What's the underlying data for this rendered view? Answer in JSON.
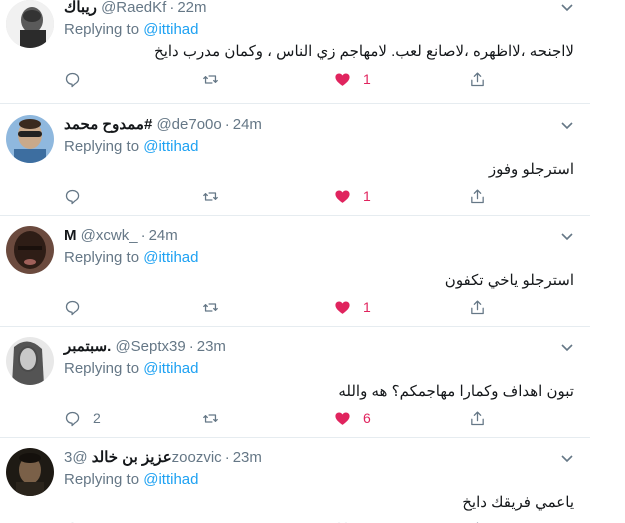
{
  "replying_label": "Replying to",
  "tweets": [
    {
      "name": "ريباك",
      "handle": "@RaedKf",
      "time": "22m",
      "reply_to": "@ittihad",
      "text": "لااجنحه ،لااظهره ،لاصانع لعب. لامهاجم زي الناس ، وكمان مدرب دايخ",
      "replies": "",
      "likes": "1",
      "avatar_bg": "#2b2b2b"
    },
    {
      "name": "ممدوح محمد#",
      "handle": "@de7o0o",
      "time": "24m",
      "reply_to": "@ittihad",
      "text": "استرجلو وفوز",
      "replies": "",
      "likes": "1",
      "avatar_bg": "#4a7fb0"
    },
    {
      "name": "M",
      "handle": "@xcwk_",
      "time": "24m",
      "reply_to": "@ittihad",
      "text": "استرجلو ياخي تكفون",
      "replies": "",
      "likes": "1",
      "avatar_bg": "#3a2a24"
    },
    {
      "name": "سبتمبر.",
      "handle": "@Septx39",
      "time": "23m",
      "reply_to": "@ittihad",
      "text": "تبون اهداف وكمارا مهاجمكم؟ هه والله",
      "replies": "2",
      "likes": "6",
      "avatar_bg": "#bfbfbf"
    },
    {
      "name": "عزيز بن خالد",
      "handle": "@3zoozvic",
      "time": "23m",
      "reply_to": "@ittihad",
      "text": "ياعمي فريقك دايخ",
      "replies": "",
      "likes": "",
      "avatar_bg": "#3c3020"
    }
  ],
  "colors": {
    "accent": "#1da1f2",
    "like": "#e0245e",
    "muted": "#657786",
    "border": "#e6ecf0"
  }
}
